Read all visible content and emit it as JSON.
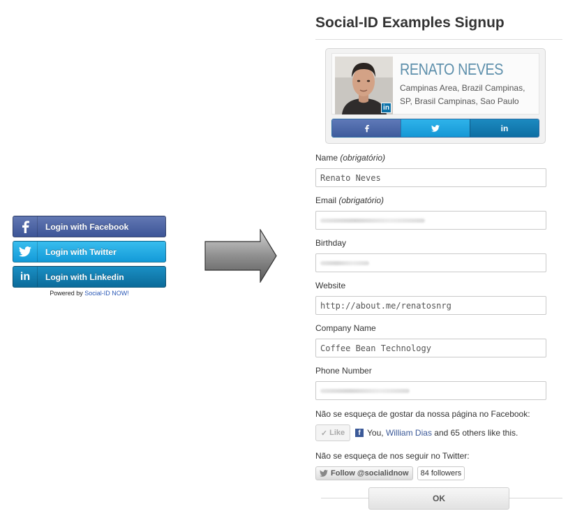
{
  "login_widget": {
    "facebook_label": "Login with Facebook",
    "twitter_label": "Login with Twitter",
    "linkedin_label": "Login with Linkedin",
    "powered_prefix": "Powered by",
    "powered_link": "Social-ID NOW!"
  },
  "signup": {
    "title": "Social-ID Examples Signup",
    "profile": {
      "name": "RENATO NEVES",
      "location": "Campinas Area, Brazil Campinas, SP, Brasil Campinas, Sao Paulo"
    },
    "fields": {
      "name_label": "Name",
      "name_required": "(obrigatório)",
      "name_value": "Renato Neves",
      "email_label": "Email",
      "email_required": "(obrigatório)",
      "birthday_label": "Birthday",
      "website_label": "Website",
      "website_value": "http://about.me/renatosnrg",
      "company_label": "Company Name",
      "company_value": "Coffee Bean Technology",
      "phone_label": "Phone Number"
    },
    "facebook_note": "Não se esqueça de gostar da nossa página no Facebook:",
    "like_button": "Like",
    "like_text_prefix": "You,",
    "like_friend": "William Dias",
    "like_text_suffix": "and 65 others like this.",
    "twitter_note": "Não se esqueça de nos seguir no Twitter:",
    "follow_button": "Follow @socialidnow",
    "followers": "84 followers",
    "ok_button": "OK"
  },
  "colors": {
    "facebook": "#3d5597",
    "twitter": "#139ad8",
    "linkedin": "#0b6b9a",
    "name_accent": "#5d8fab"
  }
}
